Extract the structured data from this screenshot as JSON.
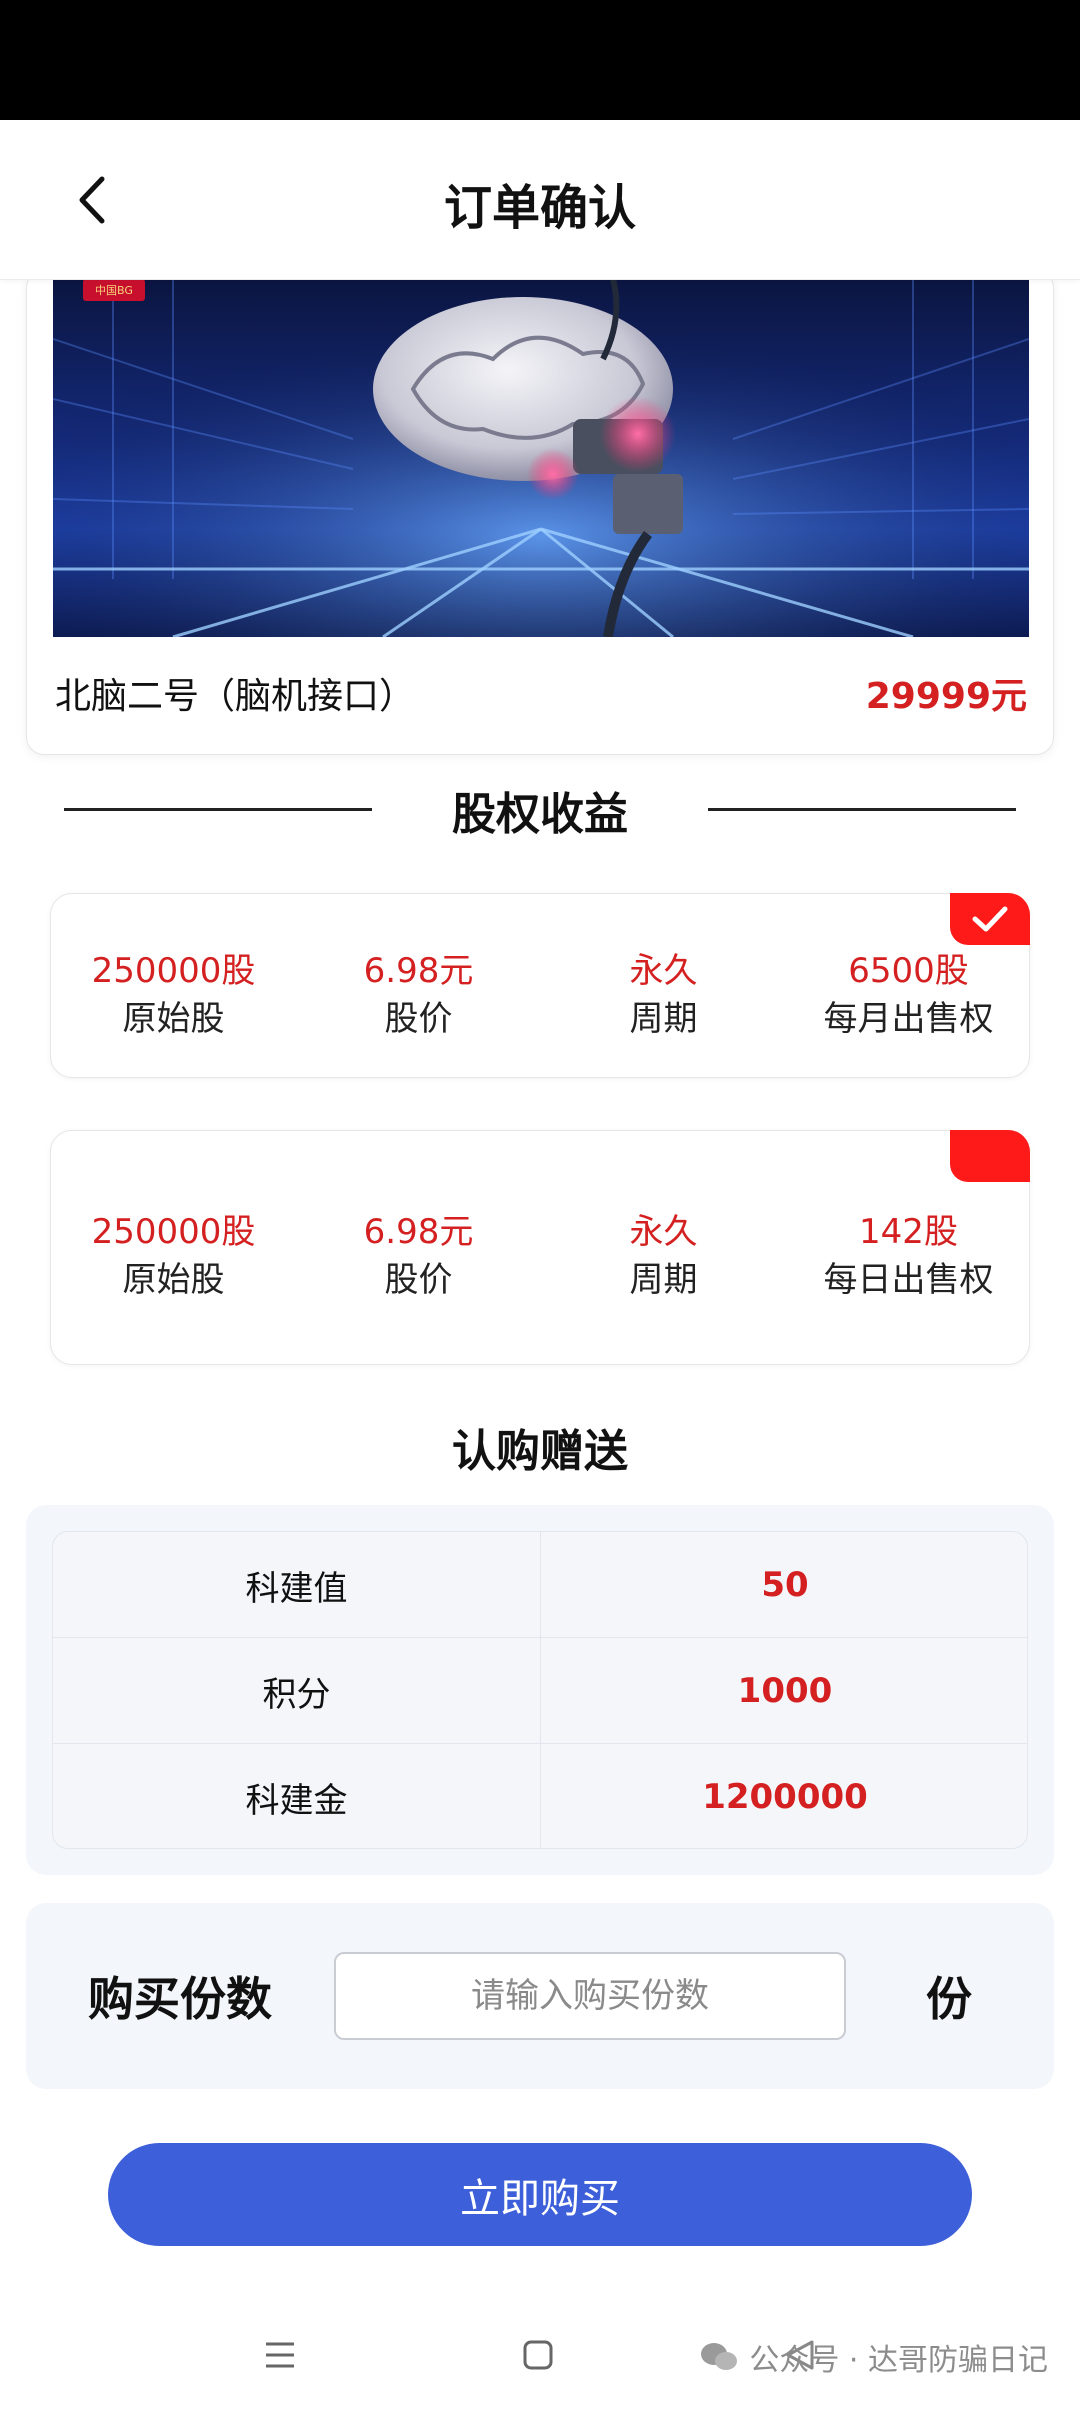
{
  "header": {
    "title": "订单确认"
  },
  "product": {
    "name": "北脑二号（脑机接口）",
    "price": "29999元",
    "banner_badge": "中国BG"
  },
  "equity": {
    "section_title": "股权收益",
    "options": [
      {
        "selected": true,
        "shares": "250000股",
        "shares_label": "原始股",
        "price": "6.98元",
        "price_label": "股价",
        "period": "永久",
        "period_label": "周期",
        "sell": "6500股",
        "sell_label": "每月出售权"
      },
      {
        "selected": false,
        "shares": "250000股",
        "shares_label": "原始股",
        "price": "6.98元",
        "price_label": "股价",
        "period": "永久",
        "period_label": "周期",
        "sell": "142股",
        "sell_label": "每日出售权"
      }
    ]
  },
  "gift": {
    "section_title": "认购赠送",
    "rows": [
      {
        "key": "科建值",
        "value": "50"
      },
      {
        "key": "积分",
        "value": "1000"
      },
      {
        "key": "科建金",
        "value": "1200000"
      }
    ]
  },
  "quantity": {
    "label": "购买份数",
    "placeholder": "请输入购买份数",
    "value": "",
    "unit": "份"
  },
  "buy_button": {
    "label": "立即购买"
  },
  "watermark": {
    "text": "公众号 · 达哥防骗日记"
  },
  "colors": {
    "accent_red": "#d42020",
    "select_tag": "#ff1a1a",
    "buy_button": "#3d5fd9"
  }
}
